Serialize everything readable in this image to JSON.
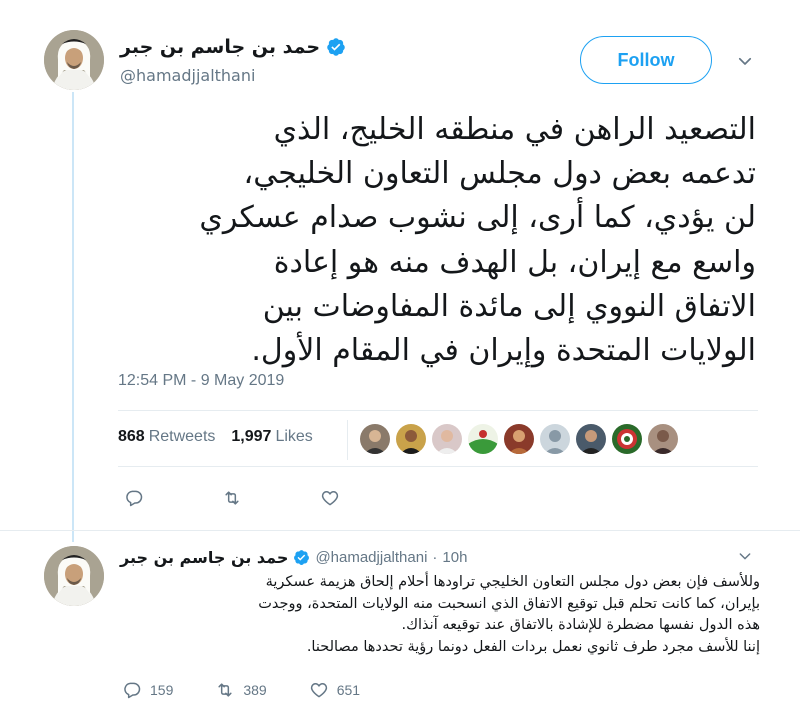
{
  "main_tweet": {
    "display_name": "حمد بن جاسم بن جبر",
    "handle": "@hamadjjalthani",
    "follow_label": "Follow",
    "text": "التصعيد الراهن في منطقه الخليج، الذي\nتدعمه بعض دول مجلس التعاون الخليجي،\nلن يؤدي، كما أرى، إلى نشوب صدام عسكري\nواسع مع إيران، بل الهدف منه هو إعادة\nالاتفاق النووي إلى مائدة المفاوضات بين\nالولايات المتحدة وإيران في المقام الأول.",
    "timestamp": "12:54 PM - 9 May 2019",
    "retweets_count": "868",
    "retweets_label": "Retweets",
    "likes_count": "1,997",
    "likes_label": "Likes"
  },
  "reply": {
    "display_name": "حمد بن جاسم بن جبر",
    "handle": "@hamadjjalthani",
    "separator": "·",
    "time": "10h",
    "text": "وللأسف فإن بعض دول مجلس التعاون الخليجي تراودها أحلام إلحاق هزيمة عسكرية\nبإيران، كما كانت تحلم قبل توقيع الاتفاق الذي انسحبت منه الولايات المتحدة، ووجدت\nهذه الدول نفسها مضطرة للإشادة بالاتفاق عند توقيعه آنذاك.\nإننا للأسف مجرد طرف ثانوي نعمل بردات الفعل دونما رؤية تحددها مصالحنا.",
    "replies_count": "159",
    "retweets_count": "389",
    "likes_count": "651"
  },
  "colors": {
    "accent": "#1da1f2",
    "muted": "#657786",
    "text": "#14171a",
    "thread_line": "#cce6f7"
  },
  "icons": [
    "verified-badge-icon",
    "chevron-down-icon",
    "reply-icon",
    "retweet-icon",
    "like-icon"
  ]
}
